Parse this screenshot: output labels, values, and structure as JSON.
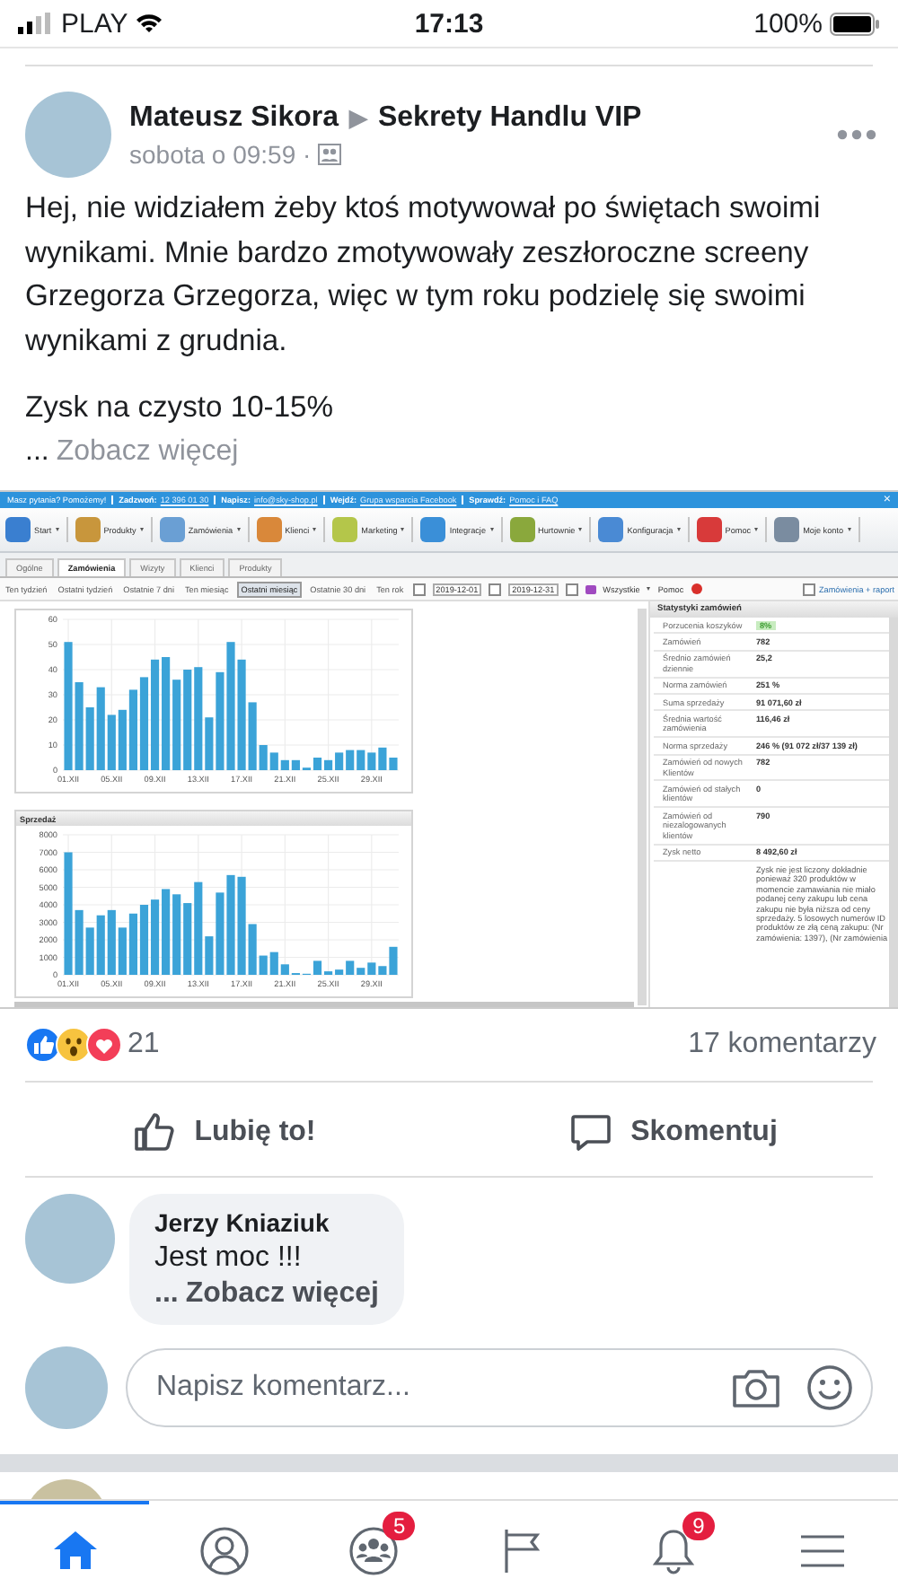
{
  "status_bar": {
    "carrier": "PLAY",
    "time": "17:13",
    "battery": "100%"
  },
  "post": {
    "author": "Mateusz Sikora",
    "arrow": "▶",
    "group": "Sekrety Handlu VIP",
    "time": "sobota o 09:59 ·",
    "paragraphs": [
      "Hej, nie widziałem żeby ktoś motywował po świętach swoimi wynikami. Mnie bardzo zmotywowały zeszłoroczne screeny Grzegorza Grzegorza, więc w tym roku podzielę się swoimi wynikami z grudnia.",
      "Zysk na czysto 10-15%"
    ],
    "more_dots": "...",
    "more": "Zobacz więcej",
    "screenshot": {
      "info_bar": [
        {
          "label": "Masz pytania? Pomożemy!"
        },
        {
          "label": "Zadzwoń:",
          "value": "12 396 01 30"
        },
        {
          "label": "Napisz:",
          "value": "info@sky-shop.pl"
        },
        {
          "label": "Wejdź:",
          "value": "Grupa wsparcia Facebook"
        },
        {
          "label": "Sprawdź:",
          "value": "Pomoc i FAQ"
        }
      ],
      "close": "×",
      "menu": [
        {
          "label": "Start",
          "color": "#3a7fd0"
        },
        {
          "label": "Produkty",
          "color": "#c8963c"
        },
        {
          "label": "Zamówienia",
          "color": "#6a9fd4"
        },
        {
          "label": "Klienci",
          "color": "#d9883a"
        },
        {
          "label": "Marketing",
          "color": "#b4c64a"
        },
        {
          "label": "Integracje",
          "color": "#3a8fd8"
        },
        {
          "label": "Hurtownie",
          "color": "#8aa83c"
        },
        {
          "label": "Konfiguracja",
          "color": "#4a8ad4"
        },
        {
          "label": "Pomoc",
          "color": "#d83a3a"
        },
        {
          "label": "Moje konto",
          "color": "#7a8ca0"
        }
      ],
      "tabs": [
        {
          "label": "Ogólne",
          "selected": false
        },
        {
          "label": "Zamówienia",
          "selected": true
        },
        {
          "label": "Wizyty",
          "selected": false
        },
        {
          "label": "Klienci",
          "selected": false
        },
        {
          "label": "Produkty",
          "selected": false
        }
      ],
      "ranges": [
        {
          "label": "Ten tydzień",
          "selected": false
        },
        {
          "label": "Ostatni tydzień",
          "selected": false
        },
        {
          "label": "Ostatnie 7 dni",
          "selected": false
        },
        {
          "label": "Ten miesiąc",
          "selected": false
        },
        {
          "label": "Ostatni miesiąc",
          "selected": true
        },
        {
          "label": "Ostatnie 30 dni",
          "selected": false
        },
        {
          "label": "Ten rok",
          "selected": false
        }
      ],
      "date_from": "2019-12-01",
      "date_to": "2019-12-31",
      "filter": "Wszystkie",
      "help": "Pomoc",
      "report": "Zamówienia + raport",
      "charts": [
        {
          "chart_data": {
            "type": "bar",
            "x": [
              1,
              2,
              3,
              4,
              5,
              6,
              7,
              8,
              9,
              10,
              11,
              12,
              13,
              14,
              15,
              16,
              17,
              18,
              19,
              20,
              21,
              22,
              23,
              24,
              25,
              26,
              27,
              28,
              29,
              30,
              31
            ],
            "xlim": [
              0.5,
              31.5
            ],
            "grid": true,
            "series": [
              {
                "color": "#3ba3d8",
                "values": [
                  51,
                  35,
                  25,
                  33,
                  22,
                  24,
                  32,
                  37,
                  44,
                  45,
                  36,
                  40,
                  41,
                  21,
                  39,
                  51,
                  44,
                  27,
                  10,
                  7,
                  4,
                  4,
                  1,
                  5,
                  4,
                  7,
                  8,
                  8,
                  7,
                  9,
                  5
                ]
              }
            ],
            "ylim": [
              0,
              60
            ],
            "yticks": [
              0,
              10,
              20,
              30,
              40,
              50,
              60
            ],
            "xticks": [
              {
                "value": 1,
                "label": "01.XII"
              },
              {
                "value": 5,
                "label": "05.XII"
              },
              {
                "value": 9,
                "label": "09.XII"
              },
              {
                "value": 13,
                "label": "13.XII"
              },
              {
                "value": 17,
                "label": "17.XII"
              },
              {
                "value": 21,
                "label": "21.XII"
              },
              {
                "value": 25,
                "label": "25.XII"
              },
              {
                "value": 29,
                "label": "29.XII"
              }
            ]
          }
        },
        {
          "chart_data": {
            "type": "bar",
            "title": "Sprzedaż",
            "x": [
              1,
              2,
              3,
              4,
              5,
              6,
              7,
              8,
              9,
              10,
              11,
              12,
              13,
              14,
              15,
              16,
              17,
              18,
              19,
              20,
              21,
              22,
              23,
              24,
              25,
              26,
              27,
              28,
              29,
              30,
              31
            ],
            "xlim": [
              0.5,
              31.5
            ],
            "grid": true,
            "series": [
              {
                "color": "#3ba3d8",
                "values": [
                  7000,
                  3700,
                  2700,
                  3400,
                  3700,
                  2700,
                  3500,
                  4000,
                  4300,
                  4900,
                  4600,
                  4100,
                  5300,
                  2200,
                  4700,
                  5700,
                  5600,
                  2900,
                  1100,
                  1300,
                  600,
                  100,
                  0,
                  800,
                  200,
                  300,
                  800,
                  400,
                  700,
                  500,
                  1600
                ]
              }
            ],
            "ylim": [
              0,
              8000
            ],
            "yticks": [
              0,
              1000,
              2000,
              3000,
              4000,
              5000,
              6000,
              7000,
              8000
            ],
            "xticks": [
              {
                "value": 1,
                "label": "01.XII"
              },
              {
                "value": 5,
                "label": "05.XII"
              },
              {
                "value": 9,
                "label": "09.XII"
              },
              {
                "value": 13,
                "label": "13.XII"
              },
              {
                "value": 17,
                "label": "17.XII"
              },
              {
                "value": 21,
                "label": "21.XII"
              },
              {
                "value": 25,
                "label": "25.XII"
              },
              {
                "value": 29,
                "label": "29.XII"
              }
            ]
          }
        }
      ],
      "stats": {
        "title": "Statystyki zamówień",
        "rows": [
          {
            "label": "Porzucenia koszyków",
            "value": "8%",
            "kind": "tag"
          },
          {
            "label": "Zamówień",
            "value": "782",
            "kind": "plain"
          },
          {
            "label": "Średnio zamówień dziennie",
            "value": "25,2",
            "kind": "plain"
          },
          {
            "label": "Norma zamówień",
            "value": "251 %",
            "kind": "plain"
          },
          {
            "label": "Suma sprzedaży",
            "value": "91 071,60 zł",
            "kind": "plain"
          },
          {
            "label": "Średnia wartość zamówienia",
            "value": "116,46 zł",
            "kind": "plain"
          },
          {
            "label": "Norma sprzedaży",
            "value": "246 % (91 072 zł/37 139 zł)",
            "kind": "plain"
          },
          {
            "label": "Zamówień od nowych Klientów",
            "value": "782",
            "kind": "plain"
          },
          {
            "label": "Zamówień od stałych klientów",
            "value": "0",
            "kind": "plain"
          },
          {
            "label": "Zamówień od niezalogowanych klientów",
            "value": "790",
            "kind": "plain"
          },
          {
            "label": "Zysk netto",
            "value": "8 492,60 zł",
            "kind": "plain"
          }
        ],
        "note": "Zysk nie jest liczony dokładnie ponieważ 320 produktów w momencie zamawiania nie miało podanej ceny zakupu lub cena zakupu nie była niższa od ceny sprzedaży. 5 losowych numerów ID produktów ze złą ceną zakupu: (Nr zamówienia: 1397), (Nr zamówienia"
      }
    }
  },
  "reactions": {
    "count": "21",
    "comments": "17 komentarzy"
  },
  "actions": [
    {
      "kind": "like",
      "label": "Lubię to!"
    },
    {
      "kind": "comment",
      "label": "Skomentuj"
    }
  ],
  "comments": [
    {
      "author": "Jerzy Kniaziuk",
      "text": "Jest moc !!!",
      "more_dots": "...",
      "more": "Zobacz więcej"
    }
  ],
  "comment_input": {
    "placeholder": "Napisz komentarz..."
  },
  "tab_bar": [
    {
      "kind": "home",
      "selected": true
    },
    {
      "kind": "profile",
      "selected": false
    },
    {
      "kind": "groups",
      "selected": false,
      "badge": "5"
    },
    {
      "kind": "pages",
      "selected": false
    },
    {
      "kind": "notifications",
      "selected": false,
      "badge": "9"
    },
    {
      "kind": "menu",
      "selected": false
    }
  ]
}
